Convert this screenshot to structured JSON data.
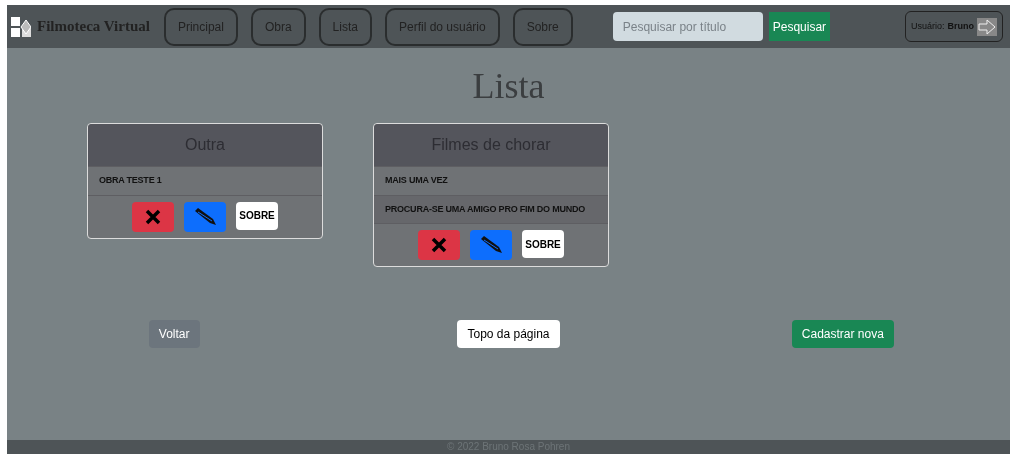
{
  "brand": "Filmoteca Virtual",
  "nav": [
    {
      "label": "Principal"
    },
    {
      "label": "Obra"
    },
    {
      "label": "Lista"
    },
    {
      "label": "Perfil do usuário"
    },
    {
      "label": "Sobre"
    }
  ],
  "search": {
    "placeholder": "Pesquisar por título",
    "button": "Pesquisar"
  },
  "user": {
    "label": "Usuário:",
    "name": "Bruno"
  },
  "title": "Lista",
  "lists": [
    {
      "name": "Outra",
      "items": [
        "OBRA TESTE 1"
      ],
      "about": "SOBRE"
    },
    {
      "name": "Filmes de chorar",
      "items": [
        "MAIS UMA VEZ",
        "PROCURA-SE UMA AMIGO PRO FIM DO MUNDO"
      ],
      "about": "SOBRE"
    }
  ],
  "actions": [
    {
      "label": "Voltar",
      "kind": "secondary"
    },
    {
      "label": "Topo da página",
      "kind": "light"
    },
    {
      "label": "Cadastrar nova",
      "kind": "success"
    }
  ],
  "footer": "© 2022 Bruno Rosa Pohren"
}
